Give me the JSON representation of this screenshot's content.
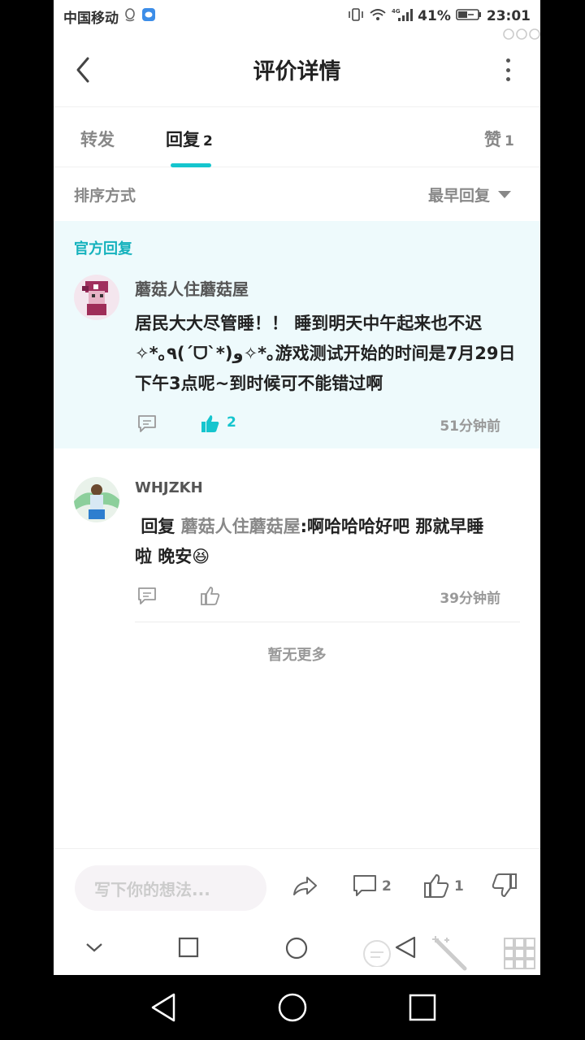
{
  "status_bar": {
    "carrier": "中国移动",
    "network": "4G",
    "battery": "41%",
    "time": "23:01"
  },
  "header": {
    "title": "评价详情"
  },
  "tabs": [
    {
      "label": "转发",
      "count": ""
    },
    {
      "label": "回复",
      "count": "2"
    },
    {
      "label": "赞",
      "count": "1"
    }
  ],
  "sort": {
    "label": "排序方式",
    "selected": "最早回复"
  },
  "official_section_label": "官方回复",
  "comments": [
    {
      "username": "蘑菇人住蘑菇屋",
      "line1": "居民大大尽管睡！！ 睡到明天中午起来也不迟",
      "line2": "✧*｡٩(ˊᗜˋ*)و✧*｡游戏测试开始的时间是7月29日",
      "line3": "下午3点呢~到时候可不能错过啊",
      "likes": "2",
      "time": "51分钟前"
    },
    {
      "username": "WHJZKH",
      "reply_prefix": "回复",
      "reply_to": "蘑菇人住蘑菇屋",
      "reply_text": ":啊哈哈哈好吧 那就早睡",
      "line2": "啦 晚安😆",
      "likes": "",
      "time": "39分钟前"
    }
  ],
  "no_more": "暂无更多",
  "bottom_bar": {
    "placeholder": "写下你的想法...",
    "comment_count": "2",
    "like_count": "1"
  }
}
